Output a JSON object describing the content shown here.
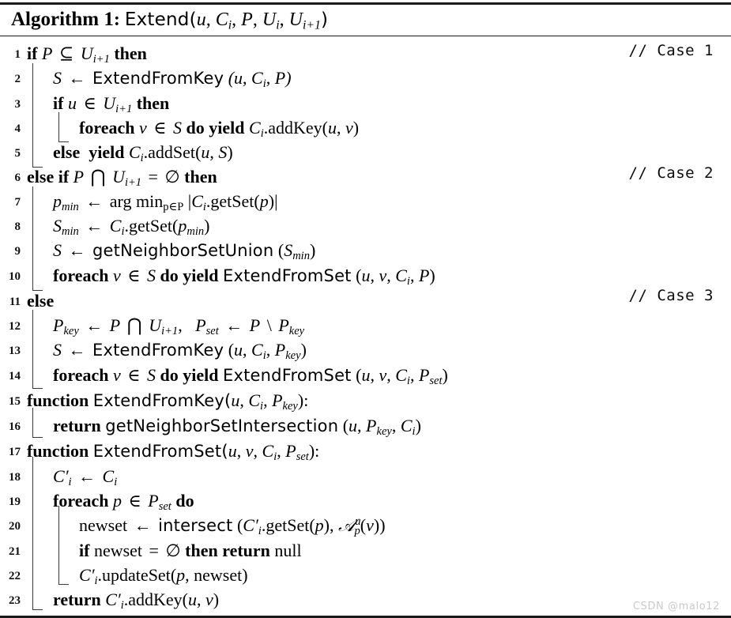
{
  "header": {
    "label": "Algorithm 1",
    "colon": ":",
    "signature_name": "Extend",
    "signature_args": "(u, C_i, P, U_i, U_{i+1})"
  },
  "comments": [
    {
      "line": 1,
      "text": "// Case 1"
    },
    {
      "line": 6,
      "text": "// Case 2"
    },
    {
      "line": 11,
      "text": "// Case 3"
    }
  ],
  "lines": [
    {
      "no": "1",
      "indent": 0,
      "text": "if P ⊆ U_{i+1} then"
    },
    {
      "no": "2",
      "indent": 1,
      "text": "S ← ExtendFromKey (u, C_i, P)"
    },
    {
      "no": "3",
      "indent": 1,
      "text": "if u ∈ U_{i+1} then"
    },
    {
      "no": "4",
      "indent": 2,
      "text": "foreach v ∈ S do yield C_i.addKey(u, v)"
    },
    {
      "no": "5",
      "indent": 1,
      "text": "else yield C_i.addSet(u, S)"
    },
    {
      "no": "6",
      "indent": 0,
      "text": "else if P ⋂ U_{i+1} = ∅ then"
    },
    {
      "no": "7",
      "indent": 1,
      "text": "p_min ← arg min_{p∈P} |C_i.getSet(p)|"
    },
    {
      "no": "8",
      "indent": 1,
      "text": "S_min ← C_i.getSet(p_min)"
    },
    {
      "no": "9",
      "indent": 1,
      "text": "S ← getNeighborSetUnion (S_min)"
    },
    {
      "no": "10",
      "indent": 1,
      "text": "foreach v ∈ S do yield ExtendFromSet (u, v, C_i, P)"
    },
    {
      "no": "11",
      "indent": 0,
      "text": "else"
    },
    {
      "no": "12",
      "indent": 1,
      "text": "P_key ← P ⋂ U_{i+1},  P_set ← P \\ P_key"
    },
    {
      "no": "13",
      "indent": 1,
      "text": "S ← ExtendFromKey (u, C_i, P_key)"
    },
    {
      "no": "14",
      "indent": 1,
      "text": "foreach v ∈ S do yield ExtendFromSet (u, v, C_i, P_set)"
    },
    {
      "no": "15",
      "indent": 0,
      "text": "function ExtendFromKey(u, C_i, P_key):"
    },
    {
      "no": "16",
      "indent": 1,
      "text": "return getNeighborSetIntersection (u, P_key, C_i)"
    },
    {
      "no": "17",
      "indent": 0,
      "text": "function ExtendFromSet(u, v, C_i, P_set):"
    },
    {
      "no": "18",
      "indent": 1,
      "text": "C'_i ← C_i"
    },
    {
      "no": "19",
      "indent": 1,
      "text": "foreach p ∈ P_set do"
    },
    {
      "no": "20",
      "indent": 2,
      "text": "newset ← intersect (C'_i.getSet(p), A^u_p(v))"
    },
    {
      "no": "21",
      "indent": 2,
      "text": "if newset = ∅ then return null"
    },
    {
      "no": "22",
      "indent": 2,
      "text": "C'_i.updateSet(p, newset)"
    },
    {
      "no": "23",
      "indent": 1,
      "text": "return C'_i.addKey(u, v)"
    }
  ],
  "keywords": {
    "if": "if",
    "then": "then",
    "else": "else",
    "foreach": "foreach",
    "do": "do",
    "yield": "yield",
    "function": "function",
    "return": "return",
    "null": "null",
    "arg_min": "arg min"
  },
  "identifiers": {
    "extend": "Extend",
    "extend_from_key": "ExtendFromKey",
    "extend_from_set": "ExtendFromSet",
    "get_neighbor_set_union": "getNeighborSetUnion",
    "get_neighbor_set_intersection": "getNeighborSetIntersection",
    "intersect": "intersect",
    "add_key": "addKey",
    "add_set": "addSet",
    "get_set": "getSet",
    "update_set": "updateSet",
    "newset": "newset"
  },
  "watermark": "CSDN @malo12",
  "colors": {
    "text": "#000000",
    "rule": "#1a1a1a",
    "guide": "#3a3a3a",
    "watermark": "#c9c9c9"
  }
}
